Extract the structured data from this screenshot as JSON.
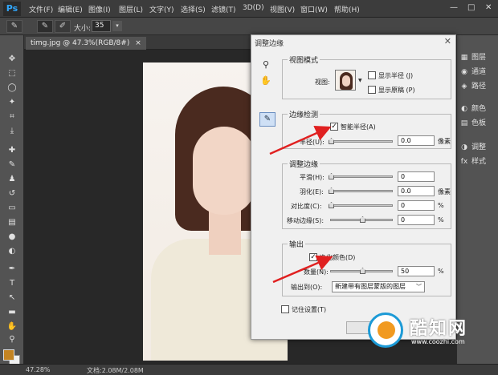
{
  "app": {
    "logo": "Ps",
    "menus": [
      "文件(F)",
      "编辑(E)",
      "图像(I)",
      "图层(L)",
      "文字(Y)",
      "选择(S)",
      "滤镜(T)",
      "3D(D)",
      "视图(V)",
      "窗口(W)",
      "帮助(H)"
    ],
    "window_controls": [
      "—",
      "□",
      "✕"
    ]
  },
  "options_bar": {
    "size_label": "大小:",
    "size_value": "35"
  },
  "document": {
    "tab_label": "timg.jpg @ 47.3%(RGB/8#)",
    "tab_close": "×"
  },
  "right_panel": {
    "items": [
      {
        "icon": "color-swatch-icon",
        "glyph": "▦",
        "label": "图层"
      },
      {
        "icon": "channels-icon",
        "glyph": "◉",
        "label": "通道"
      },
      {
        "icon": "paths-icon",
        "glyph": "◈",
        "label": "路径"
      },
      {
        "icon": "color-icon",
        "glyph": "◐",
        "label": "颜色"
      },
      {
        "icon": "swatches-icon",
        "glyph": "▤",
        "label": "色板"
      },
      {
        "icon": "adjustments-icon",
        "glyph": "◑",
        "label": "调整"
      },
      {
        "icon": "styles-icon",
        "glyph": "fx",
        "label": "样式"
      }
    ]
  },
  "status_bar": {
    "zoom": "47.28%",
    "doc_info": "文档:2.08M/2.08M"
  },
  "dialog": {
    "title": "调整边缘",
    "close": "✕",
    "view_mode": {
      "title": "视图模式",
      "view_label": "视图:",
      "show_radius": "显示半径 (J)",
      "show_original": "显示原稿 (P)"
    },
    "edge_detection": {
      "title": "边缘检测",
      "smart_radius": "智能半径(A)",
      "smart_radius_checked": true,
      "radius_label": "半径(U):",
      "radius_value": "0.0",
      "radius_unit": "像素"
    },
    "adjust_edge": {
      "title": "调整边缘",
      "smooth_label": "平滑(H):",
      "smooth_value": "0",
      "feather_label": "羽化(E):",
      "feather_value": "0.0",
      "feather_unit": "像素",
      "contrast_label": "对比度(C):",
      "contrast_value": "0",
      "contrast_unit": "%",
      "shift_label": "移动边缘(S):",
      "shift_value": "0",
      "shift_unit": "%"
    },
    "output": {
      "title": "输出",
      "decontaminate": "净化颜色(D)",
      "decontaminate_checked": true,
      "amount_label": "数量(N):",
      "amount_value": "50",
      "amount_unit": "%",
      "output_to_label": "输出到(O):",
      "output_to_value": "新建带有图层蒙版的图层"
    },
    "remember_settings": "记住设置(T)"
  },
  "watermark": {
    "text": "酷知网",
    "url": "www.coozhi.com"
  }
}
